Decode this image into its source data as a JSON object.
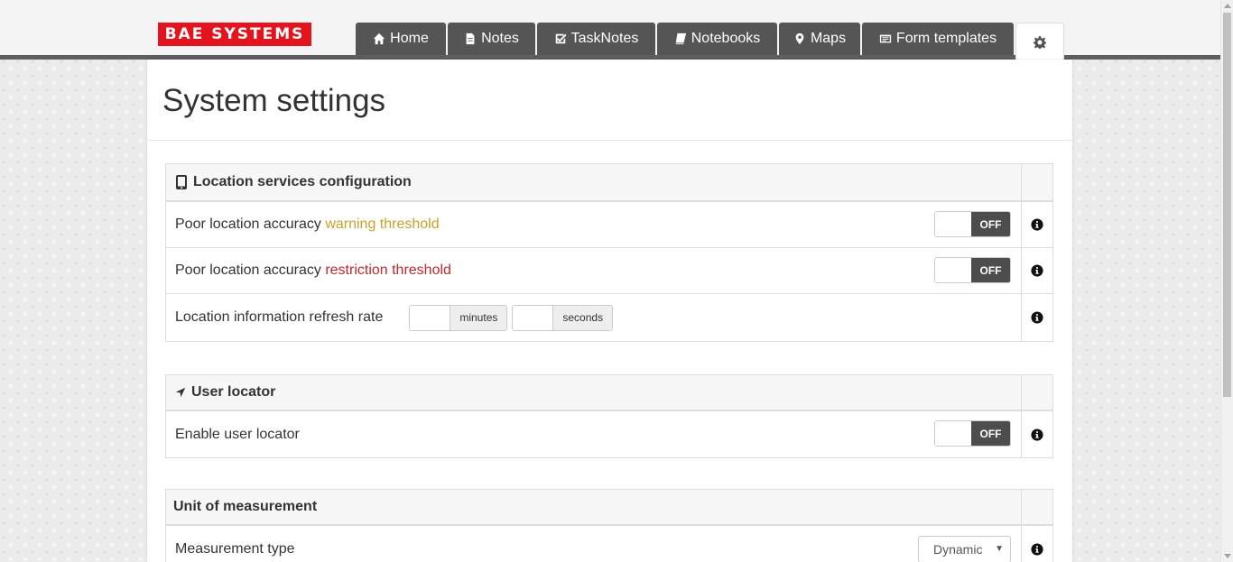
{
  "header": {
    "logo_text": "BAE SYSTEMS",
    "tabs": [
      {
        "label": "Home",
        "icon": "home-icon"
      },
      {
        "label": "Notes",
        "icon": "file-icon"
      },
      {
        "label": "TaskNotes",
        "icon": "checkbox-icon"
      },
      {
        "label": "Notebooks",
        "icon": "book-icon"
      },
      {
        "label": "Maps",
        "icon": "map-marker-icon"
      },
      {
        "label": "Form templates",
        "icon": "list-icon"
      }
    ],
    "settings_tab_icon": "gear-icon"
  },
  "page": {
    "title": "System settings"
  },
  "sections": {
    "location": {
      "title": "Location services configuration",
      "icon": "mobile-phone-icon",
      "rows": {
        "warning": {
          "label_prefix": "Poor location accuracy ",
          "label_highlight": "warning threshold",
          "toggle": "OFF"
        },
        "restriction": {
          "label_prefix": "Poor location accuracy ",
          "label_highlight": "restriction threshold",
          "toggle": "OFF"
        },
        "refresh": {
          "label": "Location information refresh rate",
          "minutes_value": "",
          "minutes_addon": "minutes",
          "seconds_value": "",
          "seconds_addon": "seconds"
        }
      }
    },
    "user_locator": {
      "title": "User locator",
      "icon": "location-arrow-icon",
      "rows": {
        "enable": {
          "label": "Enable user locator",
          "toggle": "OFF"
        }
      }
    },
    "unit": {
      "title": "Unit of measurement",
      "rows": {
        "measurement": {
          "label": "Measurement type",
          "selected": "Dynamic"
        }
      }
    }
  },
  "colors": {
    "warning": "#c9a227",
    "restriction": "#c0272d",
    "logo_bg": "#e4141e",
    "tab_bg": "#555555",
    "toggle_off_bg": "#4d4d4d"
  }
}
